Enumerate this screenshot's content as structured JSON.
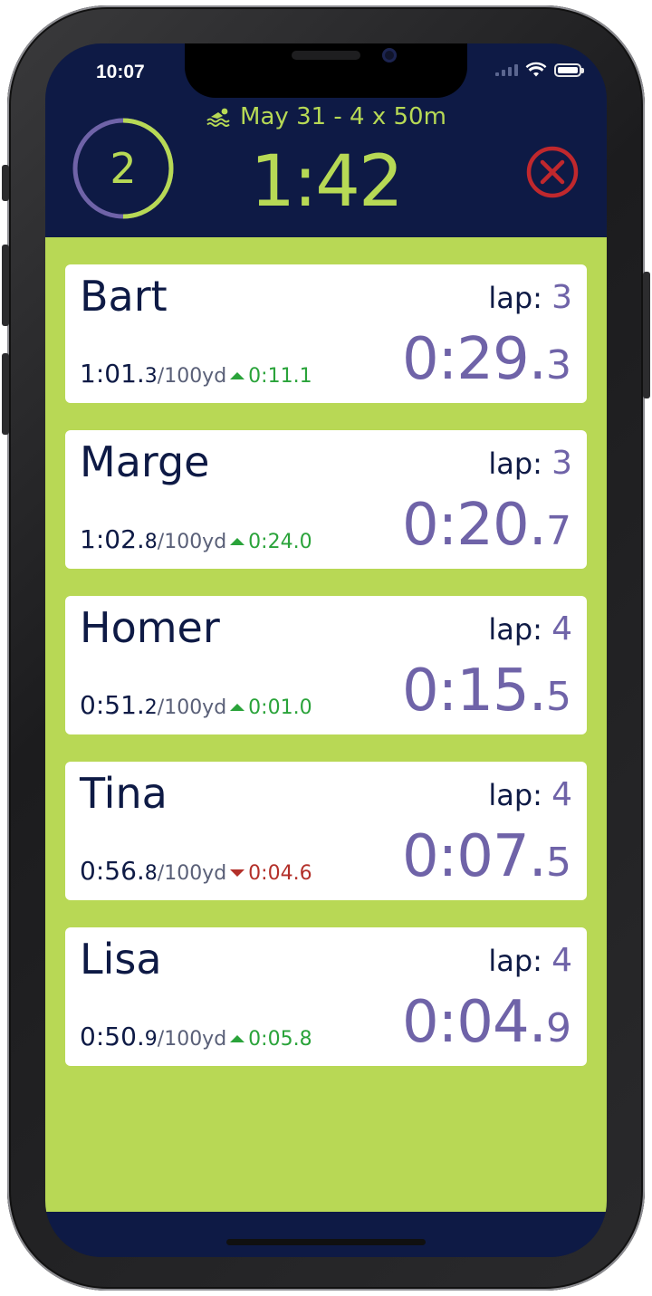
{
  "status_bar": {
    "time": "10:07"
  },
  "header": {
    "set_number": "2",
    "session_title": "May 31 - 4 x 50m",
    "elapsed_time": "1:42",
    "colors": {
      "accent": "#b7d955",
      "ring_remaining": "#6f63a8",
      "background": "#0e1a45",
      "close": "#c0282d"
    }
  },
  "swimmers": [
    {
      "name": "Bart",
      "lap_label": "lap:",
      "lap": "3",
      "pace_main": "1:01.",
      "pace_tenth": "3",
      "pace_unit": "/100yd",
      "delta_direction": "up",
      "delta_main": "0:11.",
      "delta_tenth": "1",
      "lap_time_main": "0:29.",
      "lap_time_tenth": "3"
    },
    {
      "name": "Marge",
      "lap_label": "lap:",
      "lap": "3",
      "pace_main": "1:02.",
      "pace_tenth": "8",
      "pace_unit": "/100yd",
      "delta_direction": "up",
      "delta_main": "0:24.",
      "delta_tenth": "0",
      "lap_time_main": "0:20.",
      "lap_time_tenth": "7"
    },
    {
      "name": "Homer",
      "lap_label": "lap:",
      "lap": "4",
      "pace_main": "0:51.",
      "pace_tenth": "2",
      "pace_unit": "/100yd",
      "delta_direction": "up",
      "delta_main": "0:01.",
      "delta_tenth": "0",
      "lap_time_main": "0:15.",
      "lap_time_tenth": "5"
    },
    {
      "name": "Tina",
      "lap_label": "lap:",
      "lap": "4",
      "pace_main": "0:56.",
      "pace_tenth": "8",
      "pace_unit": "/100yd",
      "delta_direction": "down",
      "delta_main": "0:04.",
      "delta_tenth": "6",
      "lap_time_main": "0:07.",
      "lap_time_tenth": "5"
    },
    {
      "name": "Lisa",
      "lap_label": "lap:",
      "lap": "4",
      "pace_main": "0:50.",
      "pace_tenth": "9",
      "pace_unit": "/100yd",
      "delta_direction": "up",
      "delta_main": "0:05.",
      "delta_tenth": "8",
      "lap_time_main": "0:04.",
      "lap_time_tenth": "9"
    }
  ],
  "colors": {
    "list_background": "#b8d855",
    "name_text": "#0e1a45",
    "lap_time": "#6f63a8",
    "delta_up": "#2aa33a",
    "delta_down": "#b3302a"
  }
}
